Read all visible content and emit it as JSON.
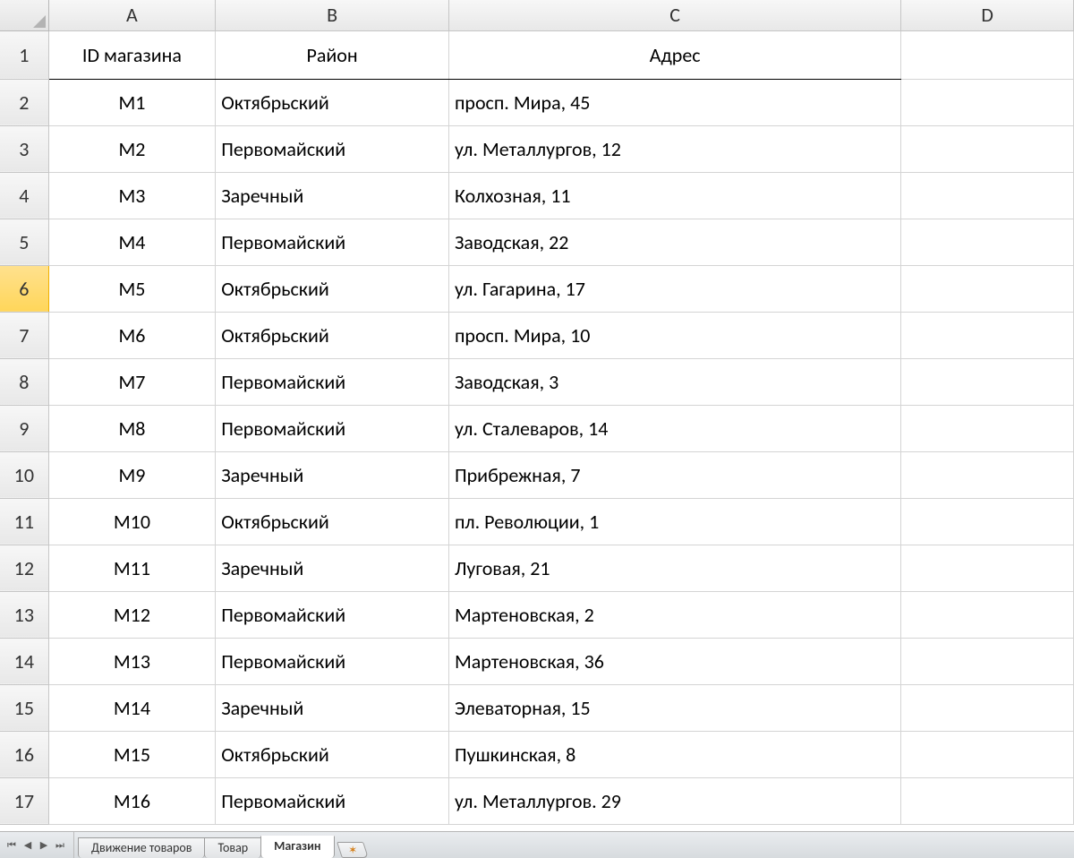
{
  "columns": [
    "A",
    "B",
    "C",
    "D"
  ],
  "rowNumbers": [
    1,
    2,
    3,
    4,
    5,
    6,
    7,
    8,
    9,
    10,
    11,
    12,
    13,
    14,
    15,
    16,
    17
  ],
  "selectedRow": 6,
  "headers": {
    "A": "ID магазина",
    "B": "Район",
    "C": "Адрес"
  },
  "rows": [
    {
      "id": "М1",
      "district": "Октябрьский",
      "address": "просп. Мира, 45"
    },
    {
      "id": "М2",
      "district": "Первомайский",
      "address": "ул. Металлургов, 12"
    },
    {
      "id": "М3",
      "district": "Заречный",
      "address": "Колхозная, 11"
    },
    {
      "id": "М4",
      "district": "Первомайский",
      "address": "Заводская, 22"
    },
    {
      "id": "М5",
      "district": "Октябрьский",
      "address": "ул. Гагарина, 17"
    },
    {
      "id": "М6",
      "district": "Октябрьский",
      "address": "просп. Мира, 10"
    },
    {
      "id": "М7",
      "district": "Первомайский",
      "address": "Заводская, 3"
    },
    {
      "id": "М8",
      "district": "Первомайский",
      "address": "ул. Сталеваров, 14"
    },
    {
      "id": "М9",
      "district": "Заречный",
      "address": "Прибрежная, 7"
    },
    {
      "id": "М10",
      "district": "Октябрьский",
      "address": "пл. Революции, 1"
    },
    {
      "id": "М11",
      "district": "Заречный",
      "address": "Луговая, 21"
    },
    {
      "id": "М12",
      "district": "Первомайский",
      "address": "Мартеновская, 2"
    },
    {
      "id": "М13",
      "district": "Первомайский",
      "address": "Мартеновская, 36"
    },
    {
      "id": "М14",
      "district": "Заречный",
      "address": "Элеваторная, 15"
    },
    {
      "id": "М15",
      "district": "Октябрьский",
      "address": "Пушкинская, 8"
    },
    {
      "id": "М16",
      "district": "Первомайский",
      "address": "ул. Металлургов. 29"
    }
  ],
  "tabs": [
    {
      "label": "Движение товаров",
      "active": false
    },
    {
      "label": "Товар",
      "active": false
    },
    {
      "label": "Магазин",
      "active": true
    }
  ],
  "navGlyphs": {
    "first": "⏮",
    "prev": "◀",
    "next": "▶",
    "last": "⏭"
  },
  "newTabGlyph": "✶"
}
